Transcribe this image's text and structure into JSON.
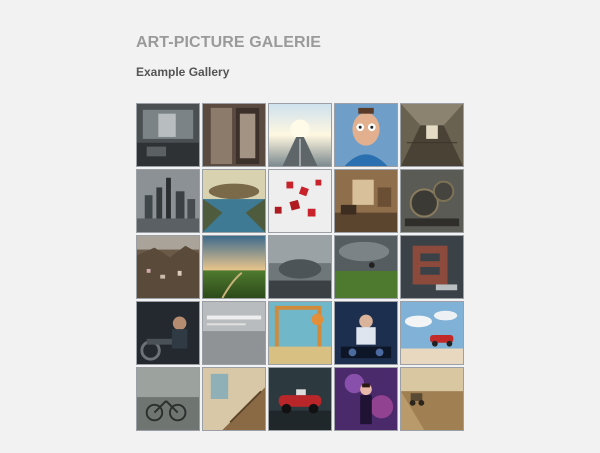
{
  "header": {
    "title": "ART-PICTURE GALERIE",
    "subtitle": "Example Gallery"
  },
  "gallery": {
    "thumbnails": [
      {
        "name": "ruined-interior",
        "caption": ""
      },
      {
        "name": "old-doorway",
        "caption": ""
      },
      {
        "name": "sunlit-road",
        "caption": ""
      },
      {
        "name": "surprised-man",
        "caption": ""
      },
      {
        "name": "abandoned-hallway",
        "caption": ""
      },
      {
        "name": "foggy-skyline",
        "caption": ""
      },
      {
        "name": "floating-island-lake",
        "caption": ""
      },
      {
        "name": "falling-dice",
        "caption": ""
      },
      {
        "name": "vintage-room",
        "caption": ""
      },
      {
        "name": "steampunk-machine",
        "caption": ""
      },
      {
        "name": "mountain-village",
        "caption": ""
      },
      {
        "name": "green-valley-sunset",
        "caption": ""
      },
      {
        "name": "cliff-landscape",
        "caption": ""
      },
      {
        "name": "stormy-field",
        "caption": ""
      },
      {
        "name": "letter-3d-art",
        "caption": ""
      },
      {
        "name": "man-on-motorcycle",
        "caption": ""
      },
      {
        "name": "text-poster",
        "caption": ""
      },
      {
        "name": "painted-frame-scene",
        "caption": ""
      },
      {
        "name": "dj-performer",
        "caption": ""
      },
      {
        "name": "flying-car-clouds",
        "caption": ""
      },
      {
        "name": "foggy-bicycle",
        "caption": ""
      },
      {
        "name": "staircase-interior",
        "caption": ""
      },
      {
        "name": "red-race-car",
        "caption": ""
      },
      {
        "name": "woman-purple-light",
        "caption": ""
      },
      {
        "name": "tractor-field",
        "caption": ""
      }
    ]
  }
}
